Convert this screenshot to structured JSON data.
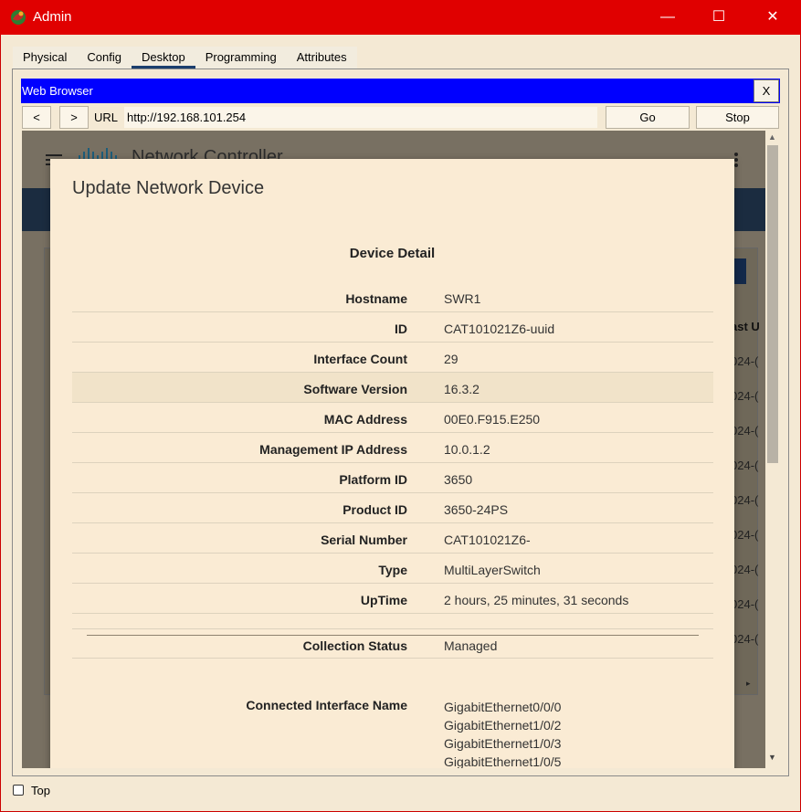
{
  "window": {
    "title": "Admin",
    "controls": {
      "minimize": "—",
      "maximize": "☐",
      "close": "✕"
    }
  },
  "tabs": [
    {
      "label": "Physical"
    },
    {
      "label": "Config"
    },
    {
      "label": "Desktop",
      "active": true
    },
    {
      "label": "Programming"
    },
    {
      "label": "Attributes"
    }
  ],
  "browser": {
    "title": "Web Browser",
    "close_label": "X",
    "back_label": "<",
    "forward_label": ">",
    "url_label": "URL",
    "url": "http://192.168.101.254",
    "go_label": "Go",
    "stop_label": "Stop"
  },
  "background_page": {
    "header_title": "Network Controller",
    "column_partial": "ast U",
    "cells_partial": [
      "024-(",
      "024-(",
      "024-(",
      "024-(",
      "024-(",
      "024-(",
      "024-(",
      "024-(",
      "024-("
    ],
    "colors": {
      "header_band": "#1b2c40",
      "action_button": "#13294a"
    }
  },
  "modal": {
    "title": "Update Network Device",
    "section_title": "Device Detail",
    "details": [
      {
        "label": "Hostname",
        "value": "SWR1"
      },
      {
        "label": "ID",
        "value": "CAT101021Z6-uuid"
      },
      {
        "label": "Interface Count",
        "value": "29"
      },
      {
        "label": "Software Version",
        "value": "16.3.2"
      },
      {
        "label": "MAC Address",
        "value": "00E0.F915.E250"
      },
      {
        "label": "Management IP Address",
        "value": "10.0.1.2"
      },
      {
        "label": "Platform ID",
        "value": "3650"
      },
      {
        "label": "Product ID",
        "value": "3650-24PS"
      },
      {
        "label": "Serial Number",
        "value": "CAT101021Z6-"
      },
      {
        "label": "Type",
        "value": "MultiLayerSwitch"
      },
      {
        "label": "UpTime",
        "value": "2 hours, 25 minutes, 31 seconds"
      }
    ],
    "collection_status": {
      "label": "Collection Status",
      "value": "Managed"
    },
    "connected_interfaces": {
      "label": "Connected Interface Name",
      "values": [
        "GigabitEthernet0/0/0",
        "GigabitEthernet1/0/2",
        "GigabitEthernet1/0/3",
        "GigabitEthernet1/0/5"
      ]
    }
  },
  "footer": {
    "top_label": "Top",
    "top_checked": false
  },
  "colors": {
    "titlebar": "#e00000",
    "browser_bar": "#0000ff",
    "background": "#f4e9d4",
    "modal_bg": "#faebd4"
  }
}
